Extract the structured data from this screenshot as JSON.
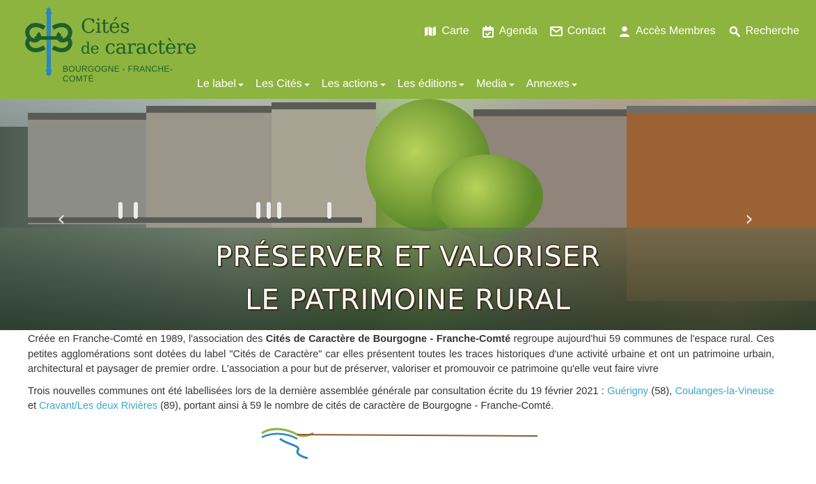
{
  "brand": {
    "title": "Cités",
    "sub_prefix": "de",
    "sub_main": "caractère",
    "region": "BOURGOGNE - FRANCHE-COMTÉ",
    "colors": {
      "header_bg": "#8db43e",
      "logo_green": "#1f5f2e",
      "logo_blue": "#2a87c4",
      "link": "#3aa7c8"
    }
  },
  "topnav": [
    {
      "label": "Carte",
      "icon": "map-icon"
    },
    {
      "label": "Agenda",
      "icon": "calendar-check-icon"
    },
    {
      "label": "Contact",
      "icon": "envelope-icon"
    },
    {
      "label": "Accès Membres",
      "icon": "user-icon"
    },
    {
      "label": "Recherche",
      "icon": "search-icon"
    }
  ],
  "mainnav": [
    {
      "label": "Le label"
    },
    {
      "label": "Les Cités"
    },
    {
      "label": "Les actions"
    },
    {
      "label": "Les éditions"
    },
    {
      "label": "Media"
    },
    {
      "label": "Annexes"
    }
  ],
  "hero": {
    "line1": "PRÉSERVER ET VALORISER",
    "line2": "LE PATRIMOINE RURAL",
    "prev": "‹",
    "next": "›"
  },
  "content": {
    "p1_start": "Créée en Franche-Comté en 1989, l'association des ",
    "p1_bold": "Cités de Caractère de Bourgogne - Franche-Comté",
    "p1_end": " regroupe aujourd'hui 59 communes de l'espace rural. Ces petites agglomérations sont dotées du label \"Cités de Caractère\" car elles présentent toutes les traces historiques d'une activité urbaine et ont un patrimoine urbain, architectural et paysager de premier ordre. L'association a pour but de préserver, valoriser et promouvoir ce patrimoine qu'elle veut faire vivre",
    "p2_start": "Trois nouvelles communes ont été labellisées lors de la dernière assemblée générale par consultation écrite du 19 février 2021 : ",
    "link1": "Guérigny",
    "p2_a": " (58), ",
    "link2": "Coulanges-la-Vineuse",
    "p2_b": " et ",
    "link3": "Cravant/Les deux Rivières",
    "p2_end": " (89), portant ainsi à 59 le nombre de cités de caractère de Bourgogne - Franche-Comté."
  }
}
